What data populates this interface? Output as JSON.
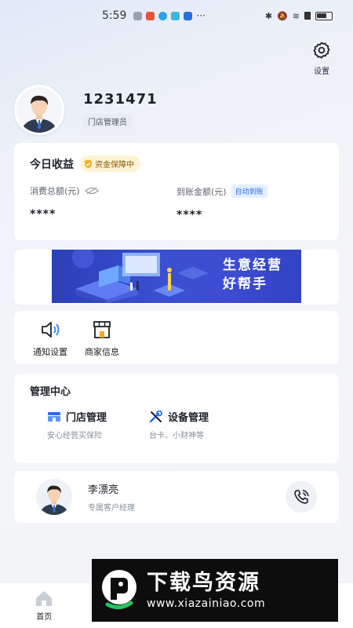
{
  "status_bar": {
    "time": "5:59",
    "dots": "···"
  },
  "settings": {
    "label": "设置"
  },
  "profile": {
    "user_id": "1231471",
    "role": "门店管理员"
  },
  "earnings": {
    "title": "今日收益",
    "badge": "资金保障中",
    "total_label": "消费总额(元)",
    "total_value": "****",
    "received_label": "到账金额(元)",
    "auto_badge": "自动到账",
    "received_value": "****"
  },
  "banner": {
    "line1": "生意经营",
    "line2": "好帮手"
  },
  "shortcuts": [
    {
      "label": "通知设置",
      "icon": "speaker-icon"
    },
    {
      "label": "商家信息",
      "icon": "store-icon"
    }
  ],
  "management": {
    "title": "管理中心",
    "items": [
      {
        "title": "门店管理",
        "subtitle": "安心经营买保险",
        "icon": "store-manage-icon"
      },
      {
        "title": "设备管理",
        "subtitle": "台卡、小财神等",
        "icon": "tools-icon"
      }
    ]
  },
  "manager": {
    "name": "李漂亮",
    "title": "专属客户经理"
  },
  "tabbar": {
    "items": [
      {
        "label": "首页"
      },
      {
        "label": ""
      },
      {
        "label": ""
      },
      {
        "label": ""
      }
    ]
  },
  "watermark": {
    "title": "下载鸟资源",
    "url": "www.xiazainiao.com"
  },
  "colors": {
    "accent": "#2b6ce8",
    "banner": "#3b4fd2",
    "badge_bg": "#fff3d6"
  }
}
